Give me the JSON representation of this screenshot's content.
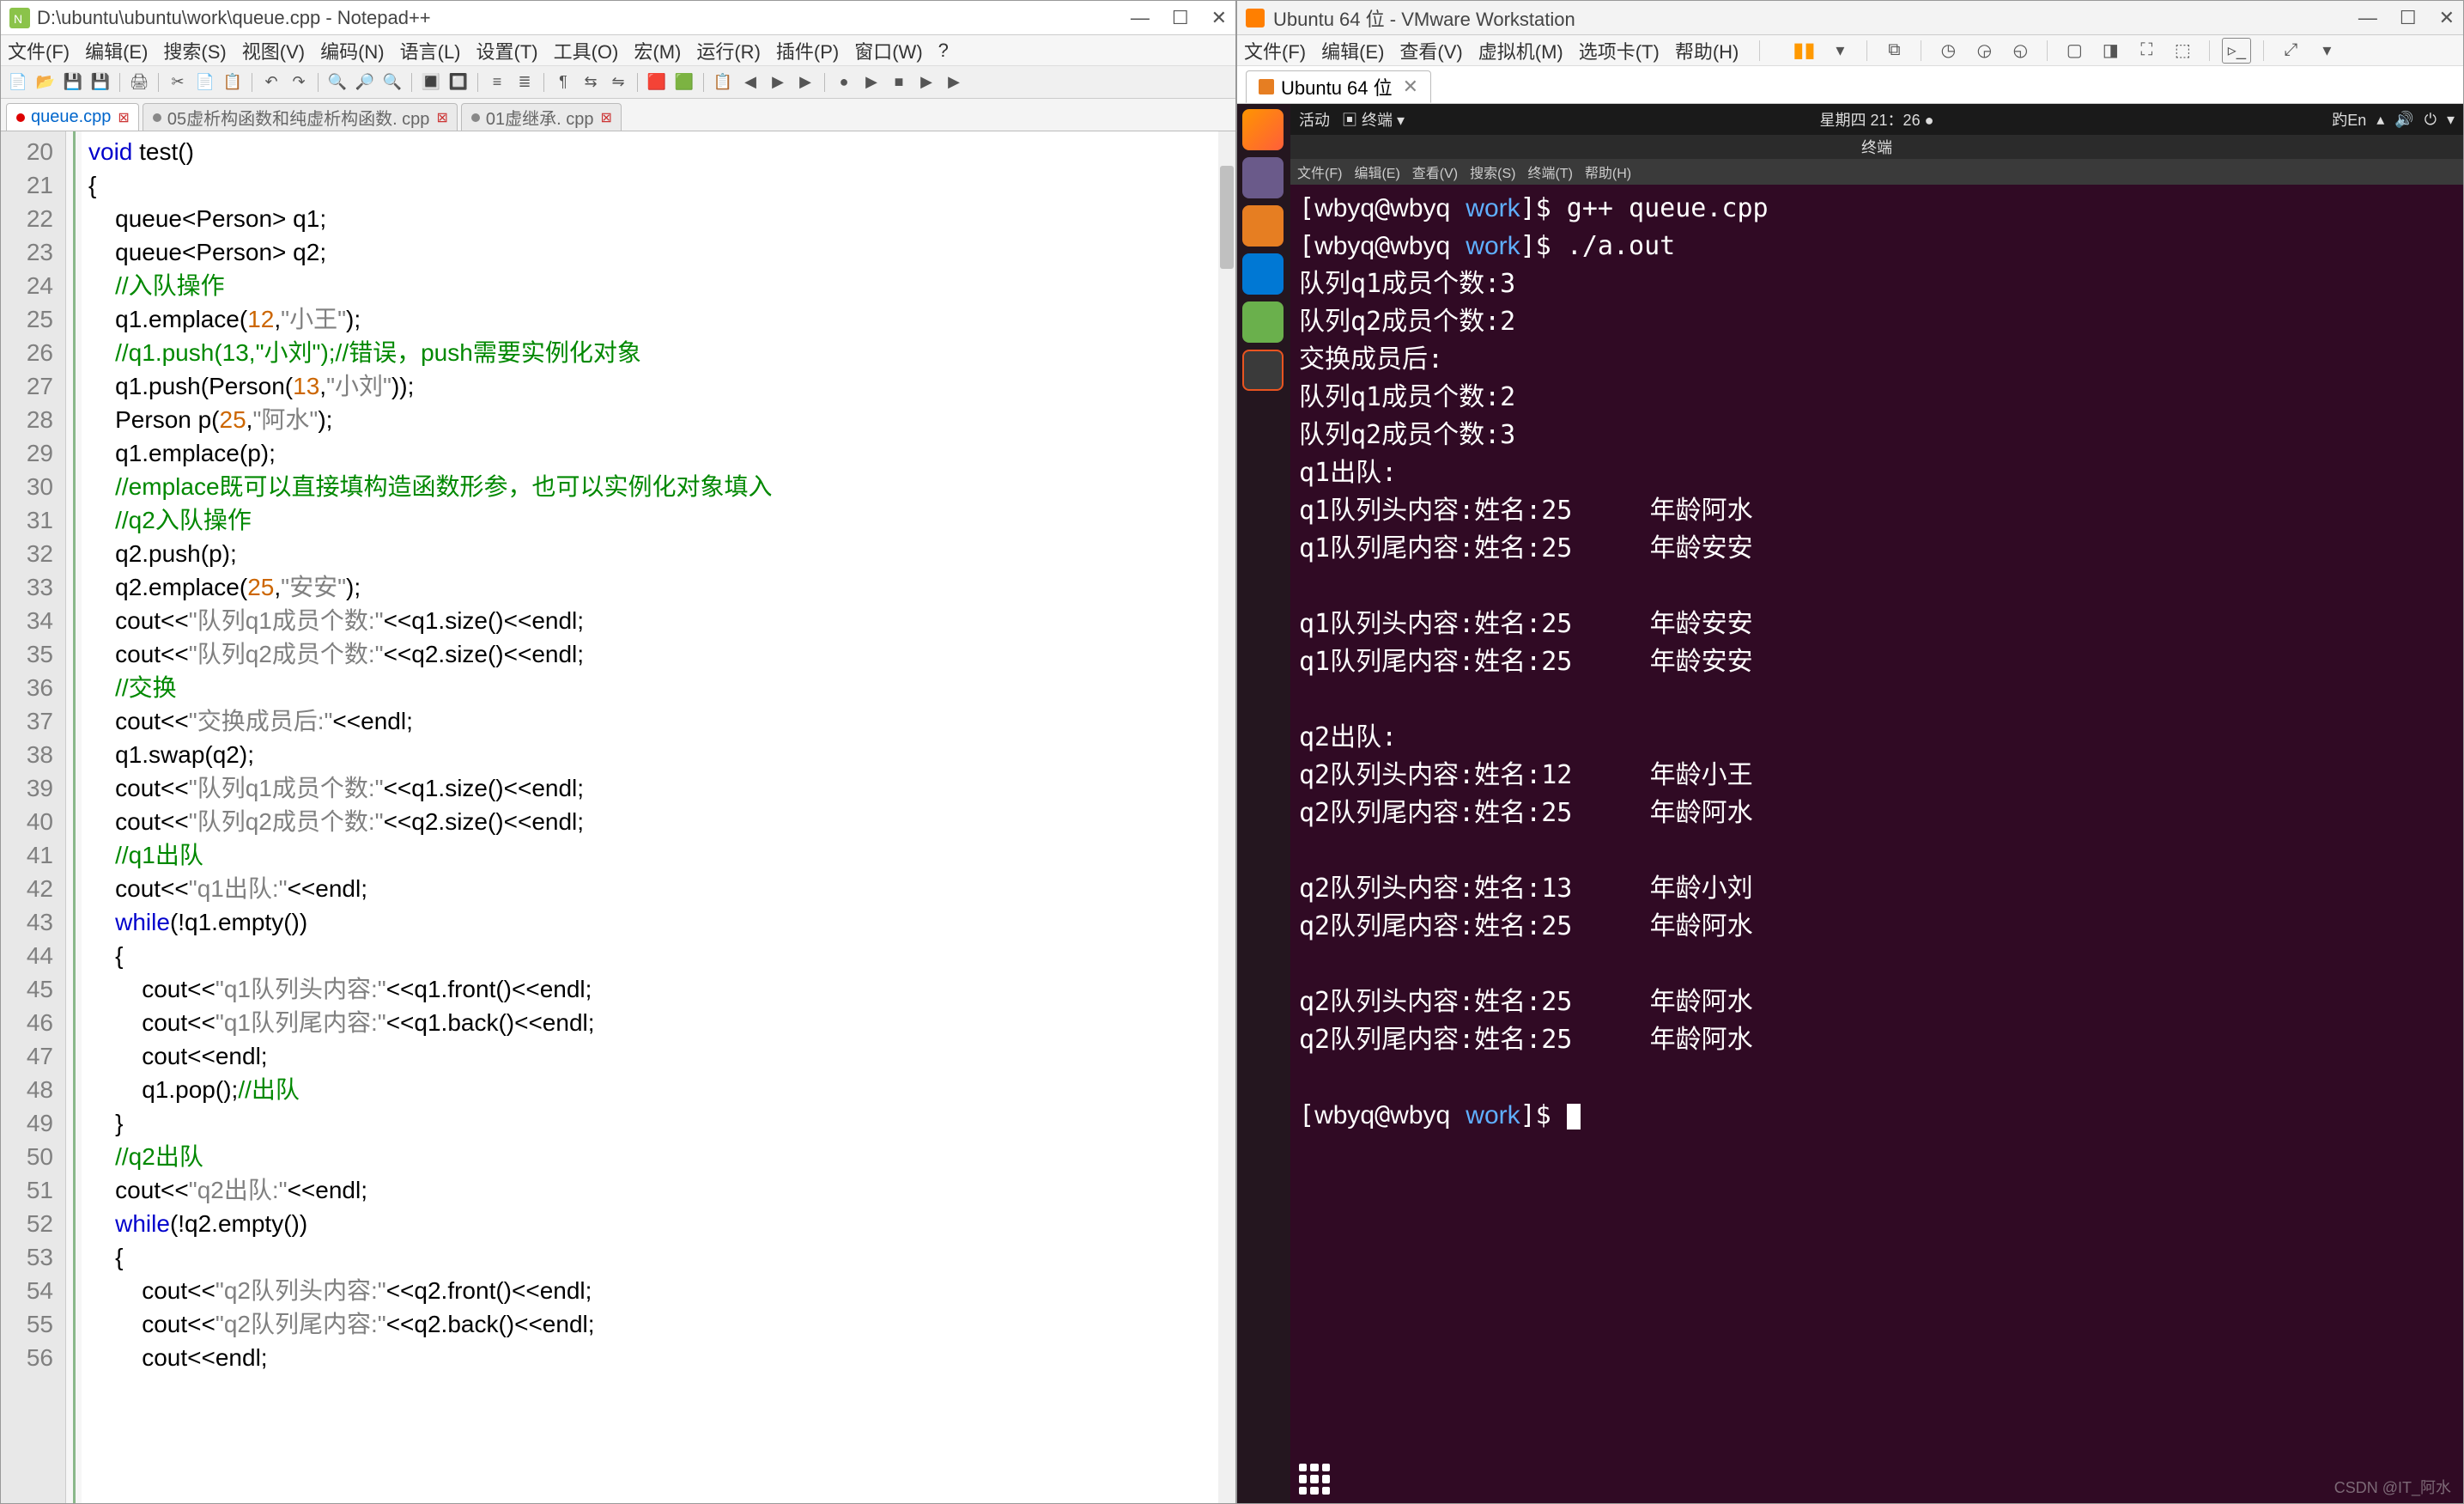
{
  "npp": {
    "title": "D:\\ubuntu\\ubuntu\\work\\queue.cpp - Notepad++",
    "menus": [
      "文件(F)",
      "编辑(E)",
      "搜索(S)",
      "视图(V)",
      "编码(N)",
      "语言(L)",
      "设置(T)",
      "工具(O)",
      "宏(M)",
      "运行(R)",
      "插件(P)",
      "窗口(W)",
      "?"
    ],
    "tabs": [
      {
        "label": "queue.cpp",
        "active": true
      },
      {
        "label": "05虚析构函数和纯虚析构函数. cpp",
        "active": false
      },
      {
        "label": "01虚继承. cpp",
        "active": false
      }
    ],
    "lines": [
      {
        "n": 20,
        "frags": [
          {
            "t": "void ",
            "c": "kw"
          },
          {
            "t": "test()"
          }
        ]
      },
      {
        "n": 21,
        "frags": [
          {
            "t": "{"
          }
        ]
      },
      {
        "n": 22,
        "frags": [
          {
            "t": "    queue<Person> q1;"
          }
        ]
      },
      {
        "n": 23,
        "frags": [
          {
            "t": "    queue<Person> q2;"
          }
        ]
      },
      {
        "n": 24,
        "frags": [
          {
            "t": "    //入队操作",
            "c": "cm"
          }
        ]
      },
      {
        "n": 25,
        "frags": [
          {
            "t": "    q1.emplace("
          },
          {
            "t": "12",
            "c": "num"
          },
          {
            "t": ","
          },
          {
            "t": "\"小王\"",
            "c": "str"
          },
          {
            "t": ");"
          }
        ]
      },
      {
        "n": 26,
        "frags": [
          {
            "t": "    //q1.push(13,\"小刘\");//错误，push需要实例化对象",
            "c": "cm"
          }
        ]
      },
      {
        "n": 27,
        "frags": [
          {
            "t": "    q1.push(Person("
          },
          {
            "t": "13",
            "c": "num"
          },
          {
            "t": ","
          },
          {
            "t": "\"小刘\"",
            "c": "str"
          },
          {
            "t": "));"
          }
        ]
      },
      {
        "n": 28,
        "frags": [
          {
            "t": "    Person p("
          },
          {
            "t": "25",
            "c": "num"
          },
          {
            "t": ","
          },
          {
            "t": "\"阿水\"",
            "c": "str"
          },
          {
            "t": ");"
          }
        ]
      },
      {
        "n": 29,
        "frags": [
          {
            "t": "    q1.emplace(p);"
          }
        ]
      },
      {
        "n": "",
        "frags": [
          {
            "t": "    //emplace既可以直接填构造函数形参，也可以实例化对象填入",
            "c": "cm"
          }
        ]
      },
      {
        "n": 30,
        "frags": [
          {
            "t": "    //q2入队操作",
            "c": "cm"
          }
        ]
      },
      {
        "n": 31,
        "frags": [
          {
            "t": "    q2.push(p);"
          }
        ]
      },
      {
        "n": 32,
        "frags": [
          {
            "t": "    q2.emplace("
          },
          {
            "t": "25",
            "c": "num"
          },
          {
            "t": ","
          },
          {
            "t": "\"安安\"",
            "c": "str"
          },
          {
            "t": ");"
          }
        ]
      },
      {
        "n": 33,
        "frags": [
          {
            "t": "    cout<<"
          },
          {
            "t": "\"队列q1成员个数:\"",
            "c": "str"
          },
          {
            "t": "<<q1.size()<<endl;"
          }
        ]
      },
      {
        "n": 34,
        "frags": [
          {
            "t": "    cout<<"
          },
          {
            "t": "\"队列q2成员个数:\"",
            "c": "str"
          },
          {
            "t": "<<q2.size()<<endl;"
          }
        ]
      },
      {
        "n": 35,
        "frags": [
          {
            "t": "    //交换",
            "c": "cm"
          }
        ]
      },
      {
        "n": 36,
        "frags": [
          {
            "t": "    cout<<"
          },
          {
            "t": "\"交换成员后:\"",
            "c": "str"
          },
          {
            "t": "<<endl;"
          }
        ]
      },
      {
        "n": 37,
        "frags": [
          {
            "t": "    q1.swap(q2);"
          }
        ]
      },
      {
        "n": 38,
        "frags": [
          {
            "t": "    cout<<"
          },
          {
            "t": "\"队列q1成员个数:\"",
            "c": "str"
          },
          {
            "t": "<<q1.size()<<endl;"
          }
        ]
      },
      {
        "n": 39,
        "frags": [
          {
            "t": "    cout<<"
          },
          {
            "t": "\"队列q2成员个数:\"",
            "c": "str"
          },
          {
            "t": "<<q2.size()<<endl;"
          }
        ]
      },
      {
        "n": 40,
        "frags": [
          {
            "t": "    //q1出队",
            "c": "cm"
          }
        ]
      },
      {
        "n": 41,
        "frags": [
          {
            "t": "    cout<<"
          },
          {
            "t": "\"q1出队:\"",
            "c": "str"
          },
          {
            "t": "<<endl;"
          }
        ]
      },
      {
        "n": 42,
        "frags": [
          {
            "t": "    "
          },
          {
            "t": "while",
            "c": "kw"
          },
          {
            "t": "(!q1.empty())"
          }
        ]
      },
      {
        "n": 43,
        "frags": [
          {
            "t": "    {"
          }
        ]
      },
      {
        "n": 44,
        "frags": [
          {
            "t": "        cout<<"
          },
          {
            "t": "\"q1队列头内容:\"",
            "c": "str"
          },
          {
            "t": "<<q1.front()<<endl;"
          }
        ]
      },
      {
        "n": 45,
        "frags": [
          {
            "t": "        cout<<"
          },
          {
            "t": "\"q1队列尾内容:\"",
            "c": "str"
          },
          {
            "t": "<<q1.back()<<endl;"
          }
        ]
      },
      {
        "n": 46,
        "frags": [
          {
            "t": "        cout<<endl;"
          }
        ]
      },
      {
        "n": 47,
        "frags": [
          {
            "t": ""
          }
        ]
      },
      {
        "n": 48,
        "frags": [
          {
            "t": "        q1.pop();"
          },
          {
            "t": "//出队",
            "c": "cm"
          }
        ]
      },
      {
        "n": 49,
        "frags": [
          {
            "t": "    }"
          }
        ]
      },
      {
        "n": 50,
        "frags": [
          {
            "t": "    //q2出队",
            "c": "cm"
          }
        ]
      },
      {
        "n": 51,
        "frags": [
          {
            "t": "    cout<<"
          },
          {
            "t": "\"q2出队:\"",
            "c": "str"
          },
          {
            "t": "<<endl;"
          }
        ]
      },
      {
        "n": 52,
        "frags": [
          {
            "t": "    "
          },
          {
            "t": "while",
            "c": "kw"
          },
          {
            "t": "(!q2.empty())"
          }
        ]
      },
      {
        "n": 53,
        "frags": [
          {
            "t": "    {"
          }
        ]
      },
      {
        "n": 54,
        "frags": [
          {
            "t": "        cout<<"
          },
          {
            "t": "\"q2队列头内容:\"",
            "c": "str"
          },
          {
            "t": "<<q2.front()<<endl;"
          }
        ]
      },
      {
        "n": 55,
        "frags": [
          {
            "t": "        cout<<"
          },
          {
            "t": "\"q2队列尾内容:\"",
            "c": "str"
          },
          {
            "t": "<<q2.back()<<endl;"
          }
        ]
      },
      {
        "n": 56,
        "frags": [
          {
            "t": "        cout<<endl;"
          }
        ]
      }
    ]
  },
  "vmw": {
    "title": "Ubuntu 64 位 - VMware Workstation",
    "menus": [
      "文件(F)",
      "编辑(E)",
      "查看(V)",
      "虚拟机(M)",
      "选项卡(T)",
      "帮助(H)"
    ],
    "tab_label": "Ubuntu 64 位"
  },
  "ubuntu": {
    "panel_left": [
      "活动",
      "▣ 终端 ▾"
    ],
    "panel_center": "星期四 21：26 ●",
    "panel_right_lang": "趵En",
    "term_menus": [
      "文件(F)",
      "编辑(E)",
      "查看(V)",
      "搜索(S)",
      "终端(T)",
      "帮助(H)"
    ],
    "term_title": "终端",
    "prompt_user": "wbyq",
    "prompt_host": "wbyq",
    "prompt_path": "work",
    "cmd1": "g++ queue.cpp",
    "cmd2": "./a.out",
    "output": [
      "队列q1成员个数:3",
      "队列q2成员个数:2",
      "交换成员后:",
      "队列q1成员个数:2",
      "队列q2成员个数:3",
      "q1出队:",
      "q1队列头内容:姓名:25     年龄阿水",
      "q1队列尾内容:姓名:25     年龄安安",
      "",
      "q1队列头内容:姓名:25     年龄安安",
      "q1队列尾内容:姓名:25     年龄安安",
      "",
      "q2出队:",
      "q2队列头内容:姓名:12     年龄小王",
      "q2队列尾内容:姓名:25     年龄阿水",
      "",
      "q2队列头内容:姓名:13     年龄小刘",
      "q2队列尾内容:姓名:25     年龄阿水",
      "",
      "q2队列头内容:姓名:25     年龄阿水",
      "q2队列尾内容:姓名:25     年龄阿水",
      ""
    ]
  },
  "watermark": "CSDN @IT_阿水"
}
